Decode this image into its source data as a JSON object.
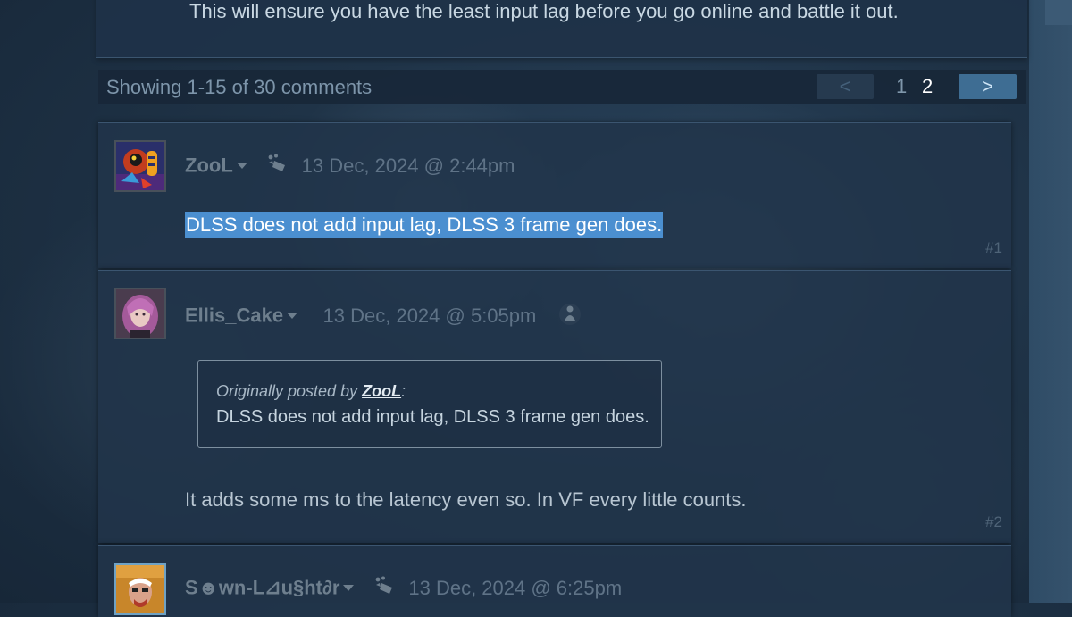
{
  "op_post": {
    "text": "This will ensure you have the least input lag before you go online and battle it out."
  },
  "pagination": {
    "summary": "Showing 1-15 of 30 comments",
    "prev_label": "<",
    "pages": [
      "1",
      "2"
    ],
    "current_page": "2",
    "next_label": ">"
  },
  "comments": [
    {
      "author": "ZooL",
      "timestamp": "13 Dec, 2024 @ 2:44pm",
      "body": "DLSS does not add input lag, DLSS 3 frame gen does.",
      "number": "#1",
      "badge_icon": "game-controller-icon"
    },
    {
      "author": "Ellis_Cake",
      "timestamp": "13 Dec, 2024 @ 5:05pm",
      "quote": {
        "prefix": "Originally posted by ",
        "author": "ZooL",
        "suffix": ":",
        "text": "DLSS does not add input lag, DLSS 3 frame gen does."
      },
      "body": "It adds some ms to the latency even so. In VF every little counts.",
      "number": "#2",
      "award_icon": "award-figure-icon"
    },
    {
      "author": "S☻wn-L⊿u§ht∂r",
      "timestamp": "13 Dec, 2024 @ 6:25pm",
      "badge_icon": "game-controller-icon"
    }
  ],
  "colors": {
    "background": "#1f3347",
    "panel": "#21344a",
    "highlight": "#4b8fd0",
    "next_button": "#3e6d93",
    "text": "#c6d4df",
    "muted": "#6e7f8e"
  }
}
